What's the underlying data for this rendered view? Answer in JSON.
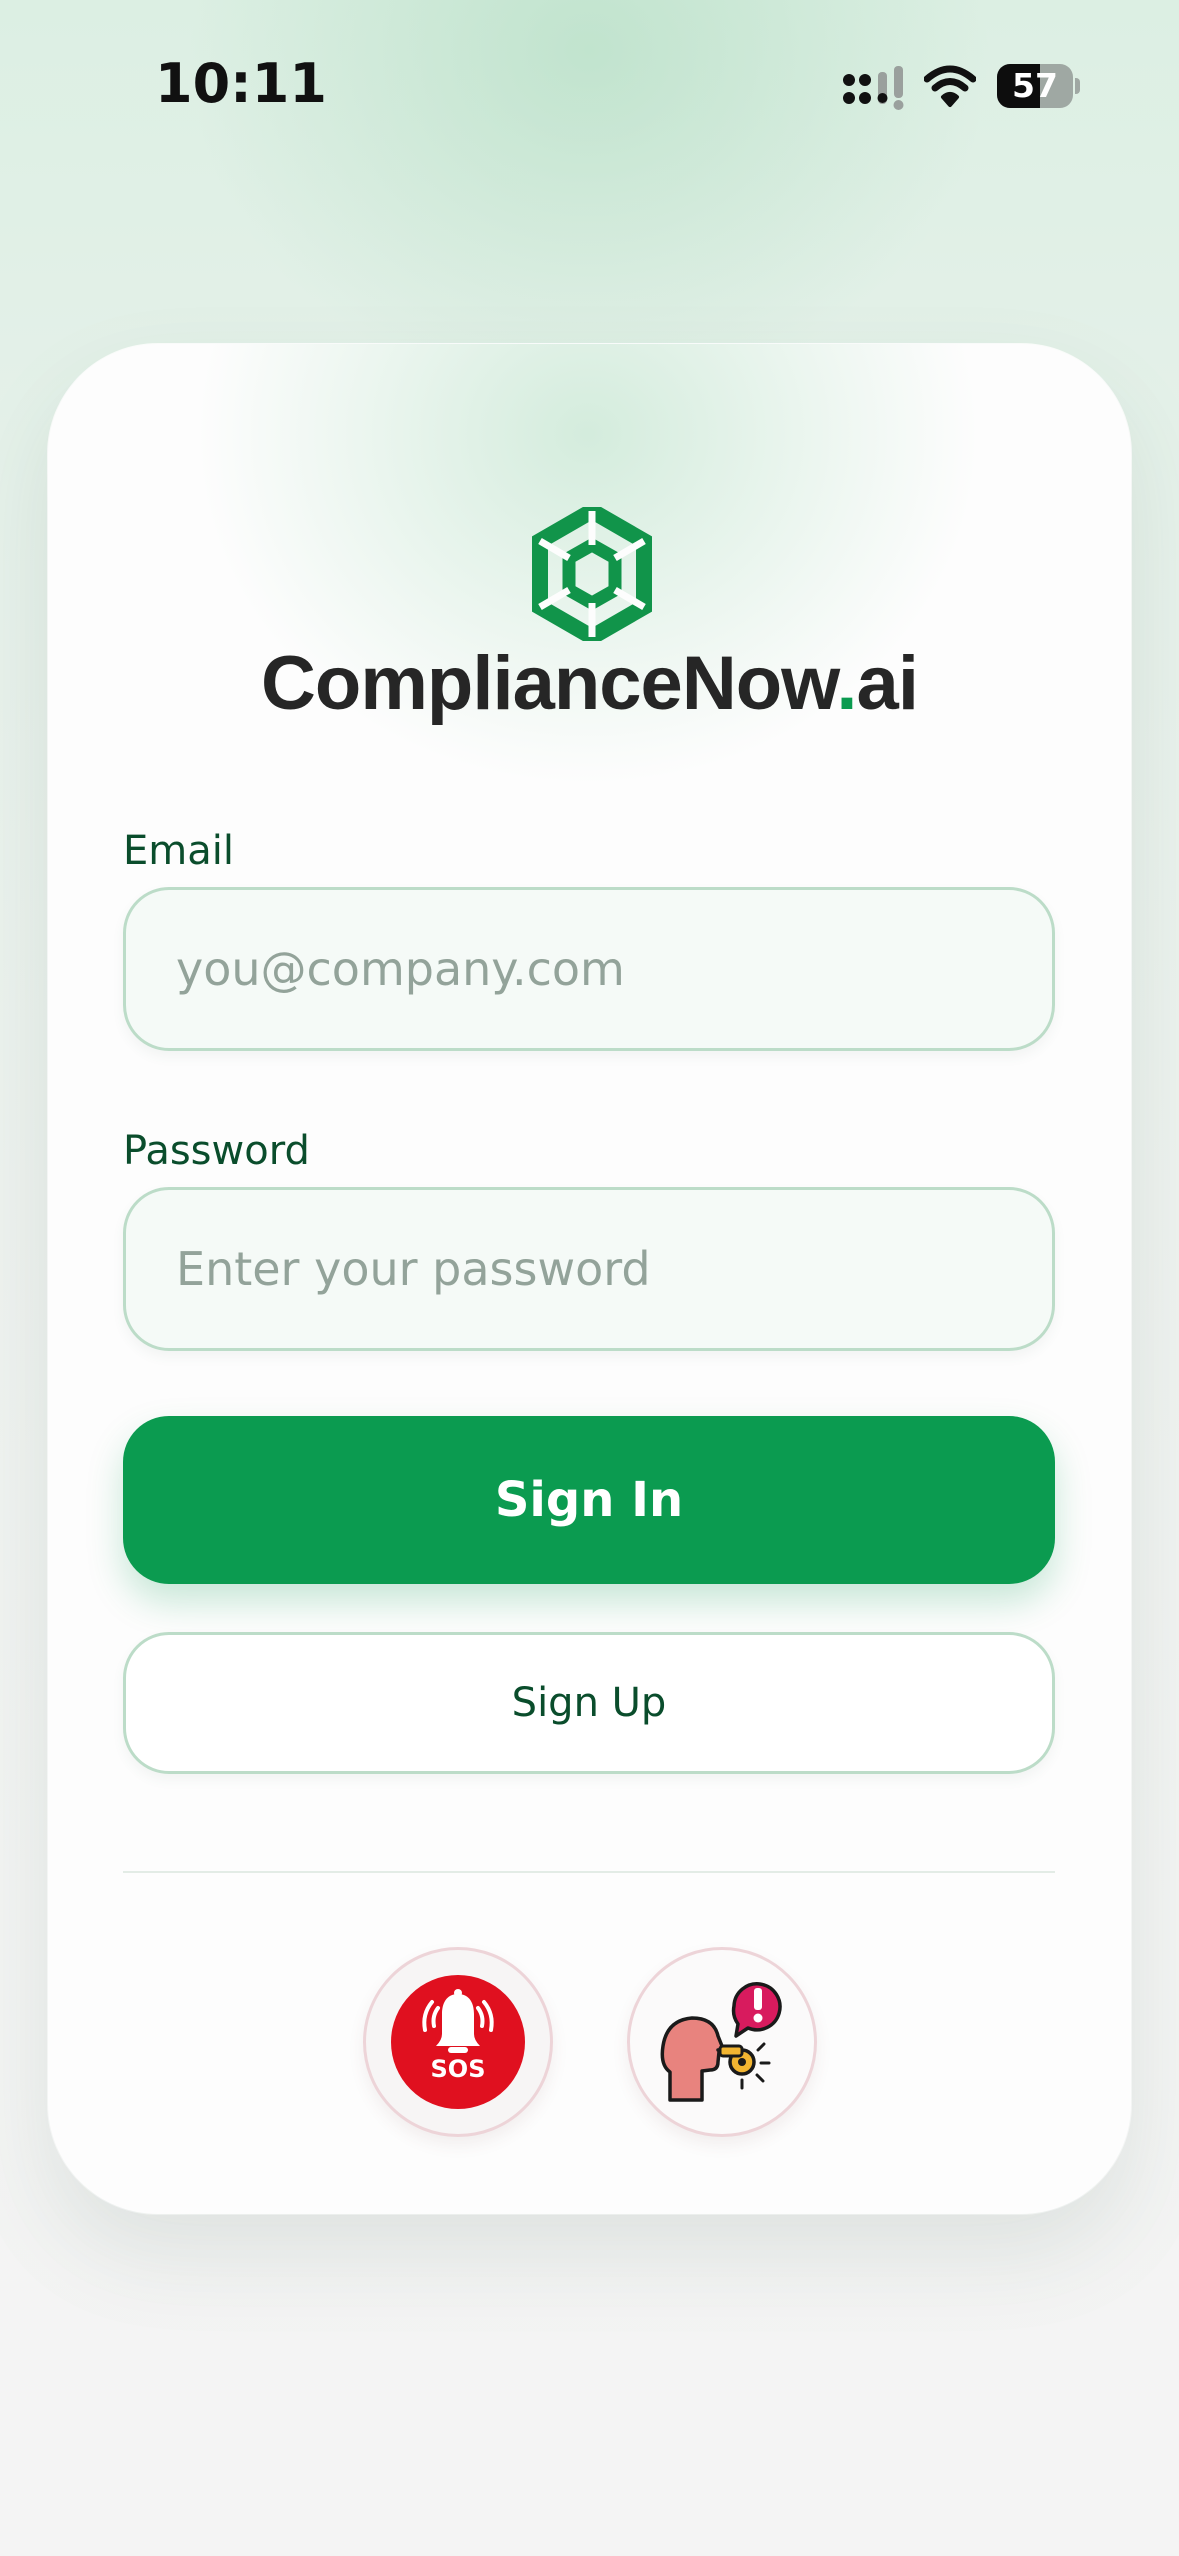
{
  "status_bar": {
    "time": "10:11",
    "battery_level": "57",
    "battery_percent": 57,
    "icons": [
      "cellular-signal-icon",
      "wifi-icon",
      "battery-icon"
    ]
  },
  "logo": {
    "mark_icon": "compliance-now-logo-icon",
    "brand_name": "ComplianceNow",
    "brand_dot": ".",
    "brand_suffix": "ai"
  },
  "form": {
    "email_label": "Email",
    "email_placeholder": "you@company.com",
    "email_value": "",
    "password_label": "Password",
    "password_placeholder": "Enter your password",
    "password_value": "",
    "sign_in_label": "Sign In",
    "sign_up_label": "Sign Up"
  },
  "quick_actions": {
    "sos_label": "SOS",
    "sos_icon": "sos-alarm-bell-icon",
    "whistleblower_icon": "whistleblower-report-icon"
  },
  "colors": {
    "accent": "#0b9b50",
    "label_text": "#0a4d2c",
    "sos_red": "#e0101f"
  }
}
